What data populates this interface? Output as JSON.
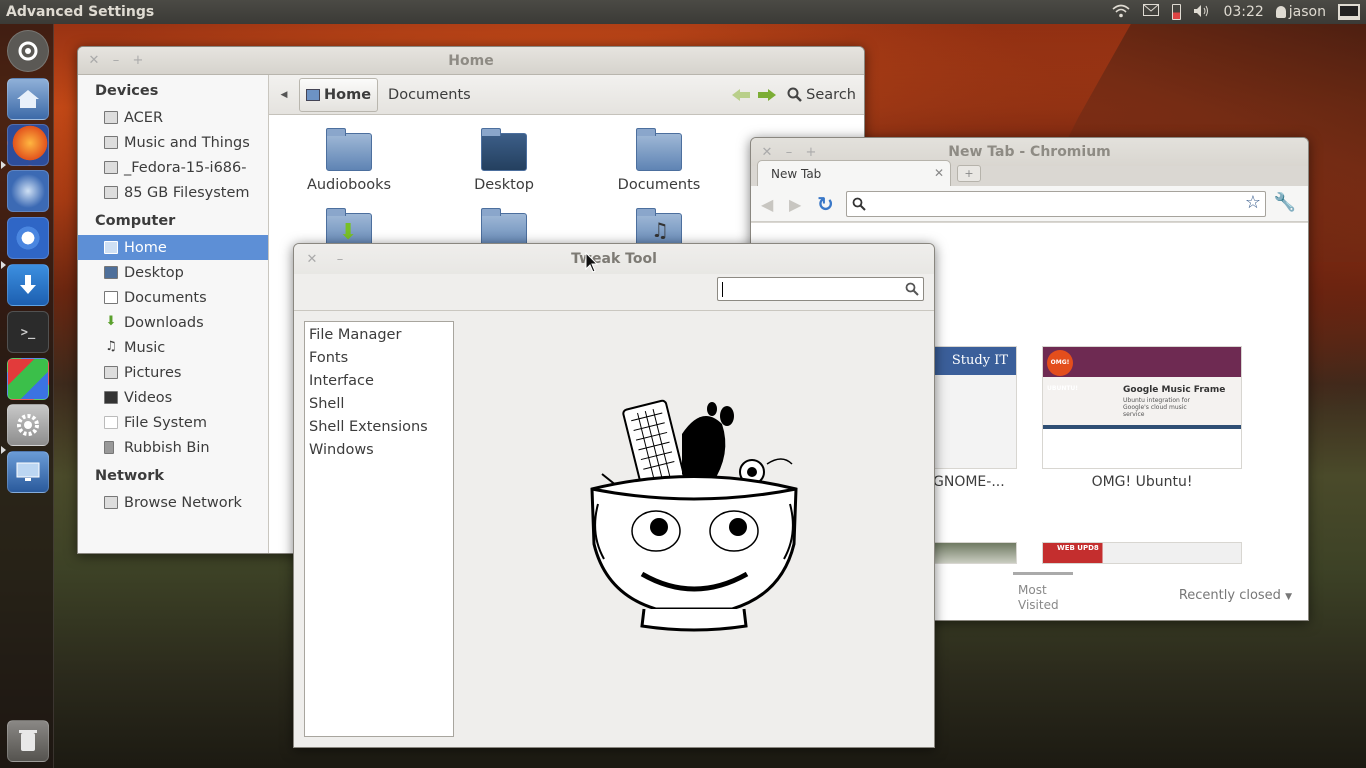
{
  "panel": {
    "app_title": "Advanced Settings",
    "clock": "03:22",
    "user": "jason"
  },
  "launcher": {
    "items": [
      "Dash",
      "Home Folder",
      "Firefox",
      "Thunderbird",
      "Chromium",
      "Ubuntu Software Center",
      "Terminal",
      "Cube",
      "System Settings",
      "Workspace Switcher",
      "Rubbish Bin"
    ]
  },
  "nautilus": {
    "title": "Home",
    "sections": [
      {
        "heading": "Devices",
        "items": [
          "ACER",
          "Music and Things",
          "_Fedora-15-i686-",
          "85 GB Filesystem"
        ]
      },
      {
        "heading": "Computer",
        "items": [
          "Home",
          "Desktop",
          "Documents",
          "Downloads",
          "Music",
          "Pictures",
          "Videos",
          "File System",
          "Rubbish Bin"
        ]
      },
      {
        "heading": "Network",
        "items": [
          "Browse Network"
        ]
      }
    ],
    "selected": "Home",
    "breadcrumb": [
      "Home",
      "Documents"
    ],
    "search_label": "Search",
    "files": [
      "Audiobooks",
      "Desktop",
      "Documents"
    ]
  },
  "chromium": {
    "title": "New Tab - Chromium",
    "tab_label": "New Tab",
    "thumbs": [
      "GNOME-...",
      "OMG! Ubuntu!"
    ],
    "thumb_texts": {
      "study": "Study IT",
      "omg_logo": "OMG! UBUNTU!",
      "omg_banner": "Google Music Frame",
      "omg_sub": "Ubuntu integration for Google's cloud music service",
      "webupd": "WEB UPD8"
    },
    "most_visited": "Most Visited",
    "recently_closed": "Recently closed"
  },
  "tweak": {
    "title": "Tweak Tool",
    "search_value": "",
    "categories": [
      "File Manager",
      "Fonts",
      "Interface",
      "Shell",
      "Shell Extensions",
      "Windows"
    ]
  },
  "colors": {
    "selection": "#5d8fd6",
    "panel": "#3b3a36"
  }
}
